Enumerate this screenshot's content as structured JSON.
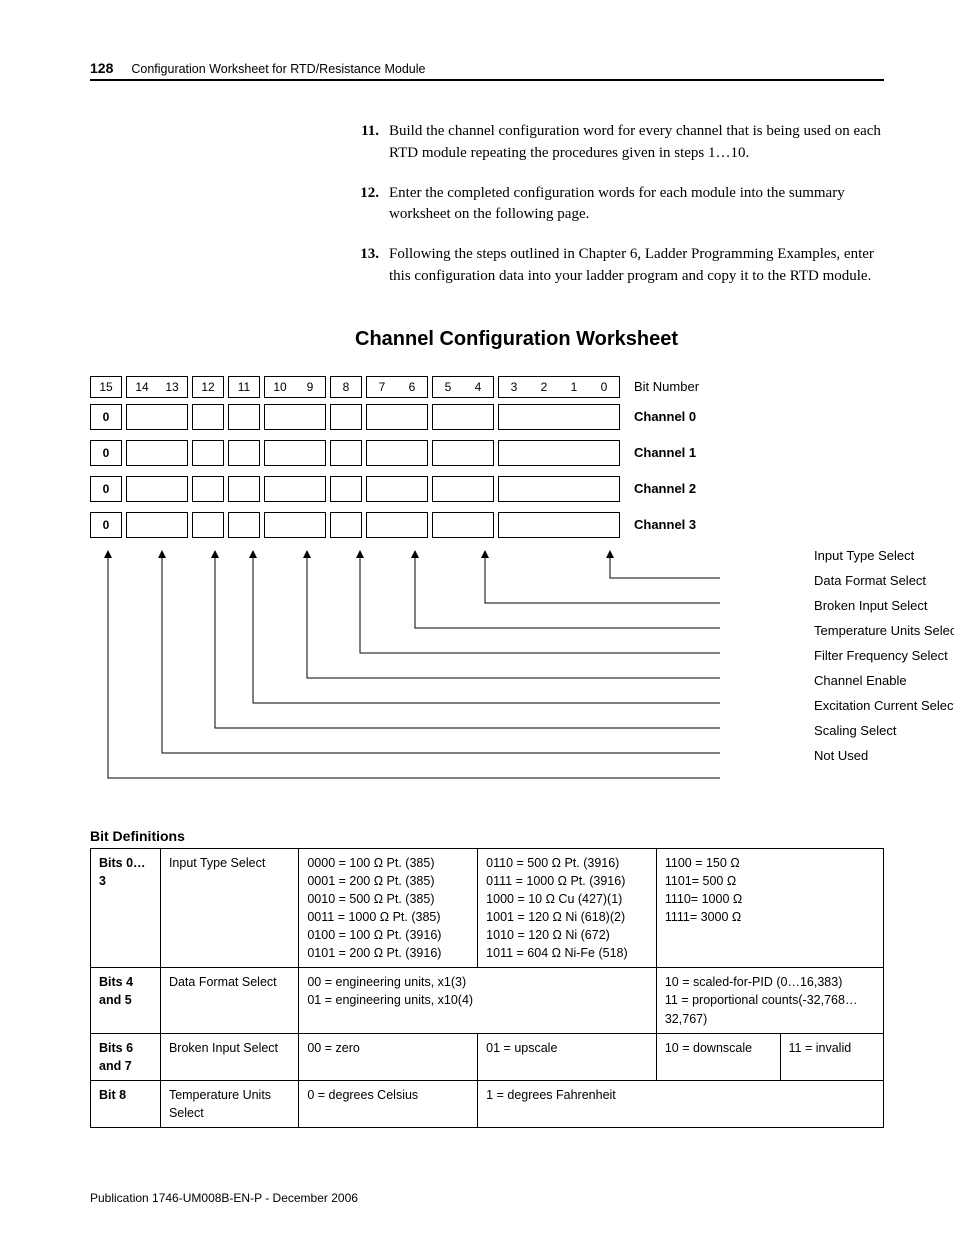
{
  "header": {
    "page_num": "128",
    "title": "Configuration Worksheet for RTD/Resistance Module"
  },
  "steps": [
    {
      "num": "11.",
      "text": "Build the channel configuration word for every channel that is being used on each RTD module repeating the procedures given in steps 1…10."
    },
    {
      "num": "12.",
      "text": "Enter the completed configuration words for each module into the summary worksheet on the following page."
    },
    {
      "num": "13.",
      "text": "Following the steps outlined in Chapter 6, Ladder Programming Examples, enter this configuration data into your ladder program and copy it to the RTD module."
    }
  ],
  "section_title": "Channel Configuration Worksheet",
  "worksheet": {
    "bit_header_label": "Bit Number",
    "bits": [
      "15",
      "14",
      "13",
      "12",
      "11",
      "10",
      "9",
      "8",
      "7",
      "6",
      "5",
      "4",
      "3",
      "2",
      "1",
      "0"
    ],
    "channel_labels": [
      "Channel 0",
      "Channel 1",
      "Channel 2",
      "Channel 3"
    ],
    "default_first_bit": "0",
    "arrow_labels": [
      "Input Type Select",
      "Data Format Select",
      "Broken Input Select",
      "Temperature Units Select",
      "Filter Frequency Select",
      "Channel Enable",
      "Excitation Current Select",
      "Scaling Select",
      "Not Used"
    ]
  },
  "bit_defs_title": "Bit Definitions",
  "defs": {
    "row1": {
      "c1": "Bits 0…3",
      "c2": "Input Type Select",
      "c3": [
        "0000 = 100 Ω Pt. (385)",
        "0001 = 200 Ω Pt. (385)",
        "0010 = 500 Ω Pt. (385)",
        "0011 = 1000 Ω Pt. (385)",
        "0100 = 100 Ω Pt. (3916)",
        "0101 = 200 Ω Pt. (3916)"
      ],
      "c4": [
        "0110 = 500 Ω Pt. (3916)",
        "0111 = 1000 Ω Pt. (3916)",
        "1000 = 10 Ω Cu (427)(1)",
        "1001 = 120 Ω Ni (618)(2)",
        "1010 = 120 Ω Ni (672)",
        "1011 = 604 Ω Ni-Fe (518)"
      ],
      "c5": [
        "1100 = 150 Ω",
        "1101= 500 Ω",
        "1110= 1000 Ω",
        "1111= 3000 Ω"
      ]
    },
    "row2": {
      "c1": "Bits 4 and 5",
      "c2": "Data Format Select",
      "c3a": "00 = engineering units, x1(3)",
      "c3b": "01 = engineering units, x10(4)",
      "c4a": "10 = scaled-for-PID (0…16,383)",
      "c4b": "11 = proportional counts(-32,768…32,767)"
    },
    "row3": {
      "c1": "Bits 6 and 7",
      "c2": "Broken Input Select",
      "c3": "00 = zero",
      "c4": "01 = upscale",
      "c5": "10 = downscale",
      "c6": "11 = invalid"
    },
    "row4": {
      "c1": "Bit 8",
      "c2": "Temperature Units Select",
      "c3": "0 = degrees Celsius",
      "c4": "1 = degrees Fahrenheit"
    }
  },
  "footer": "Publication 1746-UM008B-EN-P - December 2006"
}
